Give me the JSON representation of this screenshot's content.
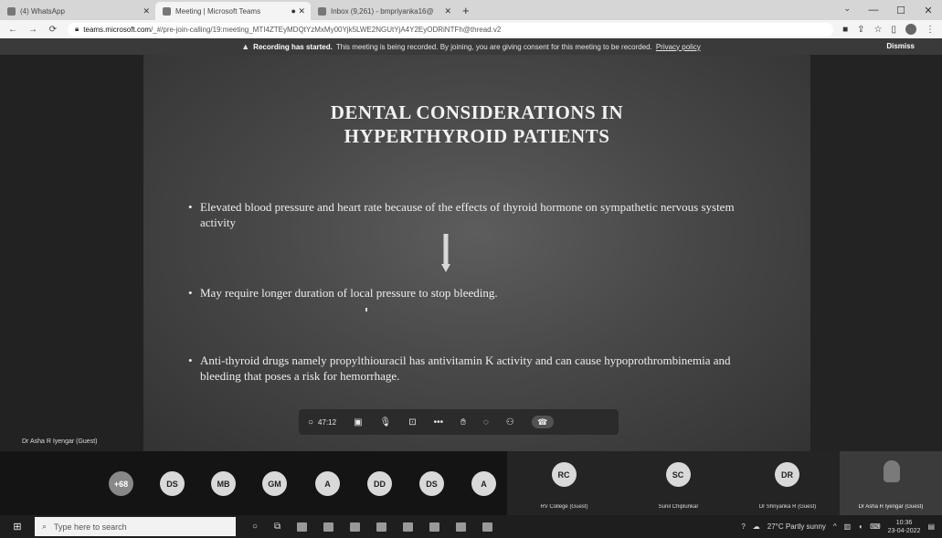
{
  "browser": {
    "tabs": [
      {
        "label": "(4) WhatsApp",
        "active": false,
        "icon": "whatsapp-icon"
      },
      {
        "label": "Meeting | Microsoft Teams",
        "active": true,
        "icon": "teams-icon"
      },
      {
        "label": "Inbox (9,261) - bmpriyanka16@",
        "active": false,
        "icon": "gmail-icon"
      }
    ],
    "new_tab": "+",
    "url_host": "teams.microsoft.com",
    "url_path": "/_#/pre-join-calling/19:meeting_MTI4ZTEyMDQtYzMxMy00Yjk5LWE2NGUtYjA4Y2EyODRiNTFh@thread.v2"
  },
  "meeting": {
    "banner": {
      "strong": "Recording has started.",
      "text": "This meeting is being recorded. By joining, you are giving consent for this meeting to be recorded.",
      "link": "Privacy policy",
      "dismiss": "Dismiss"
    },
    "slide": {
      "title_line1": "DENTAL CONSIDERATIONS IN",
      "title_line2": "HYPERTHYROID PATIENTS",
      "bullets": [
        "Elevated blood pressure and heart rate because of the effects of thyroid hormone on sympathetic nervous system activity",
        "May require longer duration of local pressure to stop bleeding.",
        "Anti-thyroid drugs namely propylthiouracil has antivitamin K activity and can cause hypoprothrombinemia and bleeding that poses a risk for hemorrhage."
      ]
    },
    "presenter_label": "Dr Asha R Iyengar (Guest)",
    "controls": {
      "timer": "47:12"
    }
  },
  "participants": {
    "more": "+68",
    "avatars": [
      "DS",
      "MB",
      "GM",
      "A",
      "DD",
      "DS",
      "A"
    ],
    "tiles": [
      {
        "initials": "RC",
        "name": "RV College (Guest)"
      },
      {
        "initials": "SC",
        "name": "Sunil Chiplunkar"
      },
      {
        "initials": "DR",
        "name": "Dr Shriyanka R (Guest)"
      }
    ],
    "self_name": "Dr Asha R Iyengar (Guest)"
  },
  "taskbar": {
    "search_placeholder": "Type here to search",
    "weather": "27°C  Partly sunny",
    "time": "10:36",
    "date": "23-04-2022"
  }
}
